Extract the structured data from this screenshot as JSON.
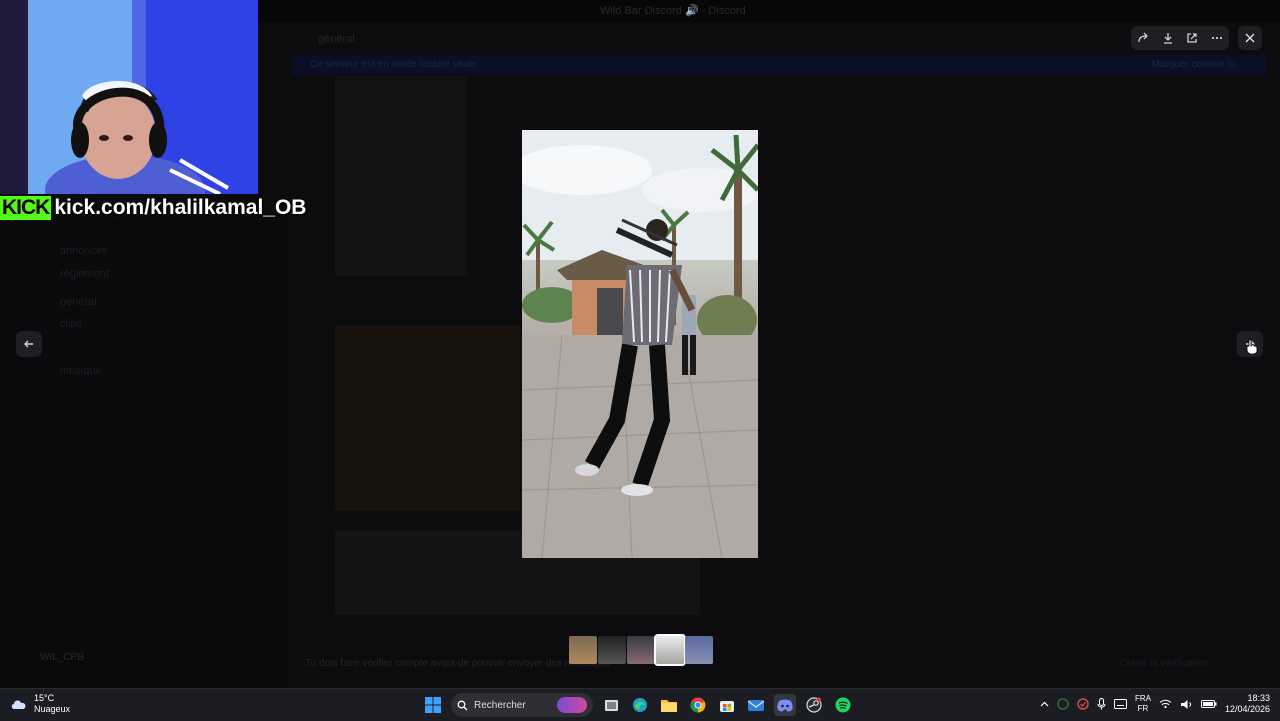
{
  "background_app": {
    "window_title": "Wild Bar Discord 🔊 - Discord",
    "channel_name": "général",
    "banner_text": "Ce serveur est en mode lecture seule",
    "banner_right": "Marquer comme lu",
    "sidebar_channels": [
      "annonces",
      "règlement",
      "général",
      "clips",
      "musique"
    ],
    "user_name": "WIL_CPB",
    "notice": "Tu dois faire vérifier compte avant de pouvoir envoyer des messages",
    "notice_right": "Ouvrir la vérification"
  },
  "viewer": {
    "toolbar": {
      "forward_icon": "forward-icon",
      "download_icon": "download-icon",
      "open_external_icon": "open-external-icon",
      "more_icon": "more-icon"
    },
    "close_icon": "close-icon",
    "prev_icon": "arrow-left-icon",
    "next_icon": "arrow-right-icon",
    "thumbnail_count": 5
  },
  "overlay": {
    "kick_logo": "KICK",
    "kick_url": "kick.com/khalilkamal_OB"
  },
  "taskbar": {
    "weather_temp": "15°C",
    "weather_desc": "Nuageux",
    "search_placeholder": "Rechercher",
    "lang_top": "FRA",
    "lang_bottom": "FR",
    "time": "18:33",
    "date": "12/04/2026"
  },
  "colors": {
    "kick_green": "#53fc18",
    "overlay_bg": "#000000",
    "button_bg": "#1e1f22"
  }
}
